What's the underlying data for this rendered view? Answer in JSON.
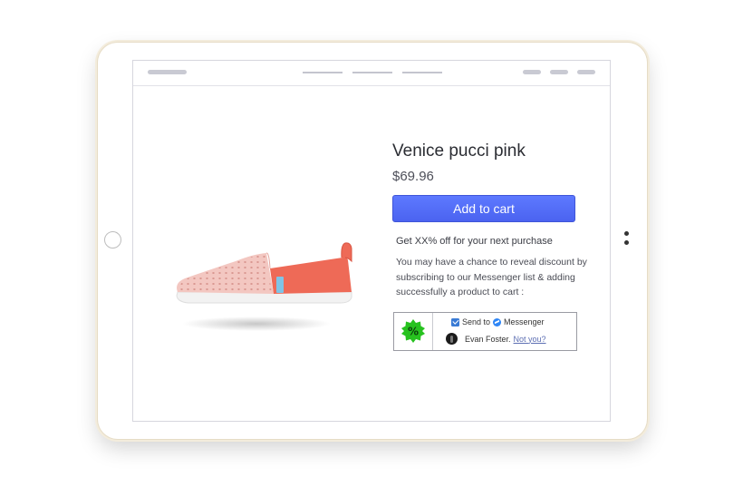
{
  "product": {
    "name": "Venice pucci pink",
    "price": "$69.96",
    "add_to_cart_label": "Add to cart"
  },
  "promo": {
    "headline": "Get XX% off for your next purchase",
    "description_lines": [
      "You may have a chance to reveal discount by",
      "subscribing to our Messenger list & adding",
      "successfully a product to cart :"
    ]
  },
  "messenger_widget": {
    "badge_symbol": "%",
    "send_to_label": "Send to",
    "messenger_label": "Messenger",
    "user_name": "Evan Foster.",
    "not_you_label": "Not you?",
    "checkbox_checked": true
  },
  "colors": {
    "accent": "#4f6bf5",
    "badge_green": "#27c21f",
    "messenger_blue": "#2f86f6",
    "shoe_pink": "#f3c7c1",
    "shoe_coral": "#ee6a57"
  }
}
